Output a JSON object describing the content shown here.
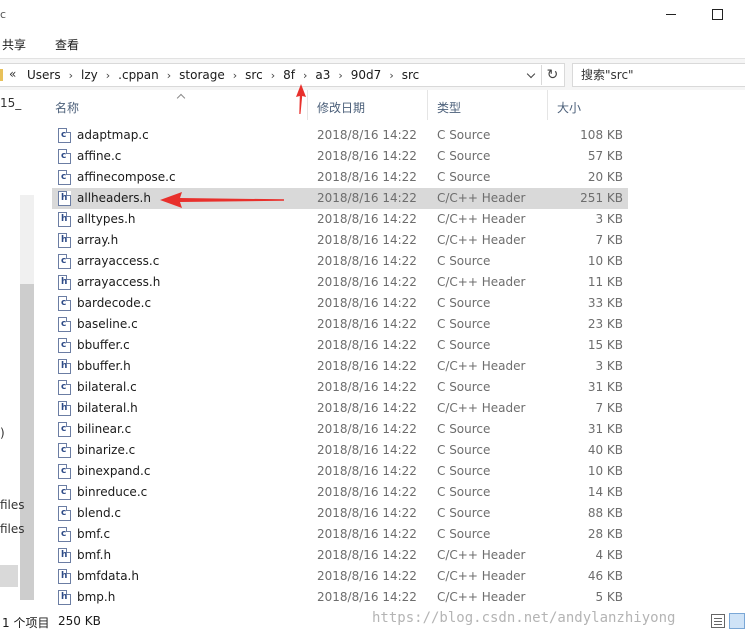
{
  "window": {
    "title_partial": "c"
  },
  "ribbon": {
    "tabs": [
      "共享",
      "查看"
    ]
  },
  "address_bar": {
    "overflow_glyph": "«",
    "path": [
      "Users",
      "lzy",
      ".cppan",
      "storage",
      "src",
      "8f",
      "a3",
      "90d7",
      "src"
    ],
    "separator": "›",
    "refresh_glyph": "↻"
  },
  "search": {
    "placeholder": "搜索\"src\""
  },
  "nav_pane": {
    "top_fragment": "15_",
    "paren_fragment": ")",
    "files_fragment_1": "files",
    "files_fragment_2": "files"
  },
  "columns": {
    "name": "名称",
    "date": "修改日期",
    "type": "类型",
    "size": "大小"
  },
  "files": [
    {
      "icon": "c",
      "name": "adaptmap.c",
      "date": "2018/8/16 14:22",
      "type": "C Source",
      "size": "108 KB"
    },
    {
      "icon": "c",
      "name": "affine.c",
      "date": "2018/8/16 14:22",
      "type": "C Source",
      "size": "57 KB"
    },
    {
      "icon": "c",
      "name": "affinecompose.c",
      "date": "2018/8/16 14:22",
      "type": "C Source",
      "size": "20 KB"
    },
    {
      "icon": "h",
      "name": "allheaders.h",
      "date": "2018/8/16 14:22",
      "type": "C/C++ Header",
      "size": "251 KB",
      "selected": true
    },
    {
      "icon": "h",
      "name": "alltypes.h",
      "date": "2018/8/16 14:22",
      "type": "C/C++ Header",
      "size": "3 KB"
    },
    {
      "icon": "h",
      "name": "array.h",
      "date": "2018/8/16 14:22",
      "type": "C/C++ Header",
      "size": "7 KB"
    },
    {
      "icon": "c",
      "name": "arrayaccess.c",
      "date": "2018/8/16 14:22",
      "type": "C Source",
      "size": "10 KB"
    },
    {
      "icon": "h",
      "name": "arrayaccess.h",
      "date": "2018/8/16 14:22",
      "type": "C/C++ Header",
      "size": "11 KB"
    },
    {
      "icon": "c",
      "name": "bardecode.c",
      "date": "2018/8/16 14:22",
      "type": "C Source",
      "size": "33 KB"
    },
    {
      "icon": "c",
      "name": "baseline.c",
      "date": "2018/8/16 14:22",
      "type": "C Source",
      "size": "23 KB"
    },
    {
      "icon": "c",
      "name": "bbuffer.c",
      "date": "2018/8/16 14:22",
      "type": "C Source",
      "size": "15 KB"
    },
    {
      "icon": "h",
      "name": "bbuffer.h",
      "date": "2018/8/16 14:22",
      "type": "C/C++ Header",
      "size": "3 KB"
    },
    {
      "icon": "c",
      "name": "bilateral.c",
      "date": "2018/8/16 14:22",
      "type": "C Source",
      "size": "31 KB"
    },
    {
      "icon": "h",
      "name": "bilateral.h",
      "date": "2018/8/16 14:22",
      "type": "C/C++ Header",
      "size": "7 KB"
    },
    {
      "icon": "c",
      "name": "bilinear.c",
      "date": "2018/8/16 14:22",
      "type": "C Source",
      "size": "31 KB"
    },
    {
      "icon": "c",
      "name": "binarize.c",
      "date": "2018/8/16 14:22",
      "type": "C Source",
      "size": "40 KB"
    },
    {
      "icon": "c",
      "name": "binexpand.c",
      "date": "2018/8/16 14:22",
      "type": "C Source",
      "size": "10 KB"
    },
    {
      "icon": "c",
      "name": "binreduce.c",
      "date": "2018/8/16 14:22",
      "type": "C Source",
      "size": "14 KB"
    },
    {
      "icon": "c",
      "name": "blend.c",
      "date": "2018/8/16 14:22",
      "type": "C Source",
      "size": "88 KB"
    },
    {
      "icon": "c",
      "name": "bmf.c",
      "date": "2018/8/16 14:22",
      "type": "C Source",
      "size": "28 KB"
    },
    {
      "icon": "h",
      "name": "bmf.h",
      "date": "2018/8/16 14:22",
      "type": "C/C++ Header",
      "size": "4 KB"
    },
    {
      "icon": "h",
      "name": "bmfdata.h",
      "date": "2018/8/16 14:22",
      "type": "C/C++ Header",
      "size": "46 KB"
    },
    {
      "icon": "h",
      "name": "bmp.h",
      "date": "2018/8/16 14:22",
      "type": "C/C++ Header",
      "size": "5 KB"
    }
  ],
  "status": {
    "selection_count": "1 个项目",
    "selection_size": "250 KB",
    "watermark": "https://blog.csdn.net/andylanzhiyong"
  },
  "colors": {
    "annotation_red": "#e8302c",
    "selected_row": "#d9d9d9",
    "header_text": "#4c607a"
  }
}
